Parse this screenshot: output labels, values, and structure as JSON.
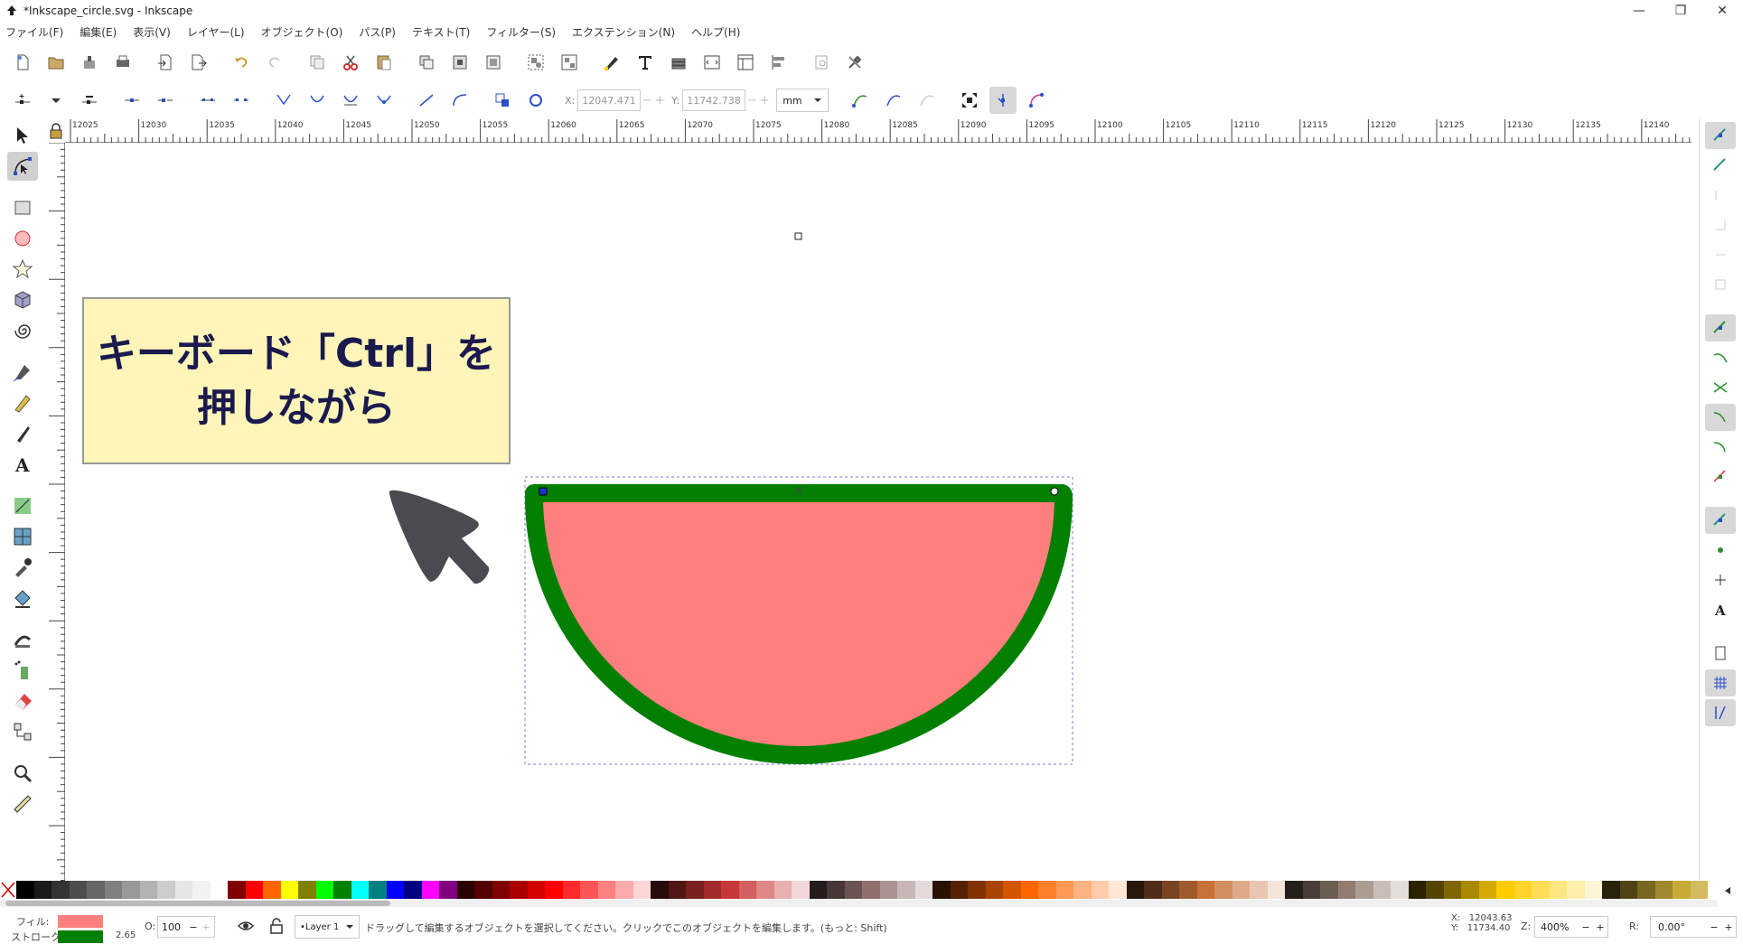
{
  "window": {
    "title": "*Inkscape_circle.svg - Inkscape",
    "minimize": "—",
    "maximize": "❐",
    "close": "✕"
  },
  "menu": [
    "ファイル(F)",
    "編集(E)",
    "表示(V)",
    "レイヤー(L)",
    "オブジェクト(O)",
    "パス(P)",
    "テキスト(T)",
    "フィルター(S)",
    "エクステンション(N)",
    "ヘルプ(H)"
  ],
  "node_toolbar": {
    "x_label": "X:",
    "x_value": "12047.471",
    "y_label": "Y:",
    "y_value": "11742.738",
    "unit": "mm"
  },
  "ruler": {
    "ticks": [
      "12025",
      "12030",
      "12035",
      "12040",
      "12045",
      "12050",
      "12055",
      "12060",
      "12065",
      "12070",
      "12075",
      "12080",
      "12085",
      "12090",
      "12095",
      "12100",
      "12105",
      "12110",
      "12115",
      "12120",
      "12125",
      "12130",
      "12135",
      "12140"
    ]
  },
  "canvas": {
    "callout_line1": "キーボード「Ctrl」を",
    "callout_line2": "押しながら"
  },
  "colors": {
    "fill": "#ff7f7f",
    "stroke": "#007f00",
    "callout_bg": "#fff5b8",
    "callout_text": "#1a1a4e"
  },
  "status": {
    "fill_label": "フィル:",
    "stroke_label": "ストローク:",
    "stroke_width": "2.65",
    "opacity_label": "O:",
    "opacity_value": "100",
    "layer": "•Layer 1",
    "message": "ドラッグして編集するオブジェクトを選択してください。クリックでこのオブジェクトを編集します。(もっと: Shift)",
    "cursor_x_label": "X:",
    "cursor_x": "12043.63",
    "cursor_y_label": "Y:",
    "cursor_y": "11734.40",
    "zoom_label": "Z:",
    "zoom": "400%",
    "rotation_label": "R:",
    "rotation": "0.00°"
  },
  "palette": [
    "#000000",
    "#1a1a1a",
    "#333333",
    "#4d4d4d",
    "#666666",
    "#808080",
    "#999999",
    "#b3b3b3",
    "#cccccc",
    "#e6e6e6",
    "#f2f2f2",
    "#ffffff",
    "#800000",
    "#ff0000",
    "#ff6600",
    "#ffff00",
    "#808000",
    "#00ff00",
    "#008000",
    "#00ffff",
    "#008080",
    "#0000ff",
    "#000080",
    "#ff00ff",
    "#800080",
    "#2b0000",
    "#550000",
    "#800000",
    "#aa0000",
    "#d40000",
    "#ff0000",
    "#ff2a2a",
    "#ff5555",
    "#ff8080",
    "#ffaaaa",
    "#ffd5d5",
    "#280b0b",
    "#501616",
    "#782121",
    "#a02c2c",
    "#c83737",
    "#d35f5f",
    "#de8787",
    "#e9afaf",
    "#f4d7d7",
    "#241c1c",
    "#483737",
    "#6c5353",
    "#916f6f",
    "#ac9393",
    "#c8b7b7",
    "#e3dbdb",
    "#2b1100",
    "#552200",
    "#803300",
    "#aa4400",
    "#d45500",
    "#ff6600",
    "#ff7f2a",
    "#ff9955",
    "#ffb380",
    "#ffccaa",
    "#ffe6d5",
    "#28170b",
    "#502d16",
    "#784421",
    "#a05a2c",
    "#c87137",
    "#d38d5f",
    "#deaa87",
    "#e9c6af",
    "#f4e3d7",
    "#241f1c",
    "#483e37",
    "#6c5d53",
    "#917c6f",
    "#ac9d93",
    "#c8beb7",
    "#e3dedb",
    "#2b2200",
    "#554400",
    "#806600",
    "#aa8800",
    "#d4aa00",
    "#ffcc00",
    "#ffd42a",
    "#ffdd55",
    "#ffe680",
    "#ffeeaa",
    "#fff6d5",
    "#28220b",
    "#504416",
    "#786721",
    "#a0892c",
    "#c8ab37",
    "#d3bc5f"
  ]
}
